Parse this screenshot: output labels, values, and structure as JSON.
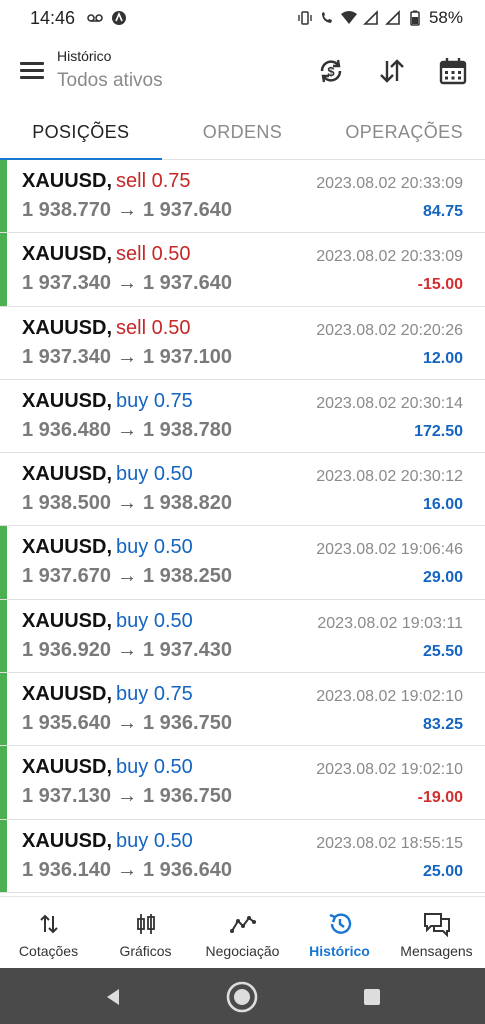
{
  "status_bar": {
    "time": "14:46",
    "battery": "58%"
  },
  "header": {
    "title": "Histórico",
    "subtitle": "Todos ativos"
  },
  "tabs": [
    {
      "label": "POSIÇÕES",
      "active": true
    },
    {
      "label": "ORDENS",
      "active": false
    },
    {
      "label": "OPERAÇÕES",
      "active": false
    }
  ],
  "positions": [
    {
      "symbol": "XAUUSD,",
      "side": "sell",
      "volume": "sell 0.75",
      "open": "1 938.770",
      "close": "1 937.640",
      "time": "2023.08.02 20:33:09",
      "profit": "84.75",
      "bar": "#4caf50"
    },
    {
      "symbol": "XAUUSD,",
      "side": "sell",
      "volume": "sell 0.50",
      "open": "1 937.340",
      "close": "1 937.640",
      "time": "2023.08.02 20:33:09",
      "profit": "-15.00",
      "bar": "#4caf50"
    },
    {
      "symbol": "XAUUSD,",
      "side": "sell",
      "volume": "sell 0.50",
      "open": "1 937.340",
      "close": "1 937.100",
      "time": "2023.08.02 20:20:26",
      "profit": "12.00",
      "bar": ""
    },
    {
      "symbol": "XAUUSD,",
      "side": "buy",
      "volume": "buy 0.75",
      "open": "1 936.480",
      "close": "1 938.780",
      "time": "2023.08.02 20:30:14",
      "profit": "172.50",
      "bar": ""
    },
    {
      "symbol": "XAUUSD,",
      "side": "buy",
      "volume": "buy 0.50",
      "open": "1 938.500",
      "close": "1 938.820",
      "time": "2023.08.02 20:30:12",
      "profit": "16.00",
      "bar": ""
    },
    {
      "symbol": "XAUUSD,",
      "side": "buy",
      "volume": "buy 0.50",
      "open": "1 937.670",
      "close": "1 938.250",
      "time": "2023.08.02 19:06:46",
      "profit": "29.00",
      "bar": "#4caf50"
    },
    {
      "symbol": "XAUUSD,",
      "side": "buy",
      "volume": "buy 0.50",
      "open": "1 936.920",
      "close": "1 937.430",
      "time": "2023.08.02 19:03:11",
      "profit": "25.50",
      "bar": "#4caf50"
    },
    {
      "symbol": "XAUUSD,",
      "side": "buy",
      "volume": "buy 0.75",
      "open": "1 935.640",
      "close": "1 936.750",
      "time": "2023.08.02 19:02:10",
      "profit": "83.25",
      "bar": "#4caf50"
    },
    {
      "symbol": "XAUUSD,",
      "side": "buy",
      "volume": "buy 0.50",
      "open": "1 937.130",
      "close": "1 936.750",
      "time": "2023.08.02 19:02:10",
      "profit": "-19.00",
      "bar": "#4caf50"
    },
    {
      "symbol": "XAUUSD,",
      "side": "buy",
      "volume": "buy 0.50",
      "open": "1 936.140",
      "close": "1 936.640",
      "time": "2023.08.02 18:55:15",
      "profit": "25.00",
      "bar": "#4caf50"
    }
  ],
  "arrow": "→",
  "bottom_nav": [
    {
      "label": "Cotações",
      "icon": "quotes-icon",
      "active": false
    },
    {
      "label": "Gráficos",
      "icon": "charts-icon",
      "active": false
    },
    {
      "label": "Negociação",
      "icon": "trade-icon",
      "active": false
    },
    {
      "label": "Histórico",
      "icon": "history-icon",
      "active": true
    },
    {
      "label": "Mensagens",
      "icon": "messages-icon",
      "active": false
    }
  ],
  "colors": {
    "accent": "#1976d2",
    "sell": "#c62828",
    "buy": "#1565c0",
    "loss": "#d32f2f",
    "active_bar": "#4caf50"
  }
}
